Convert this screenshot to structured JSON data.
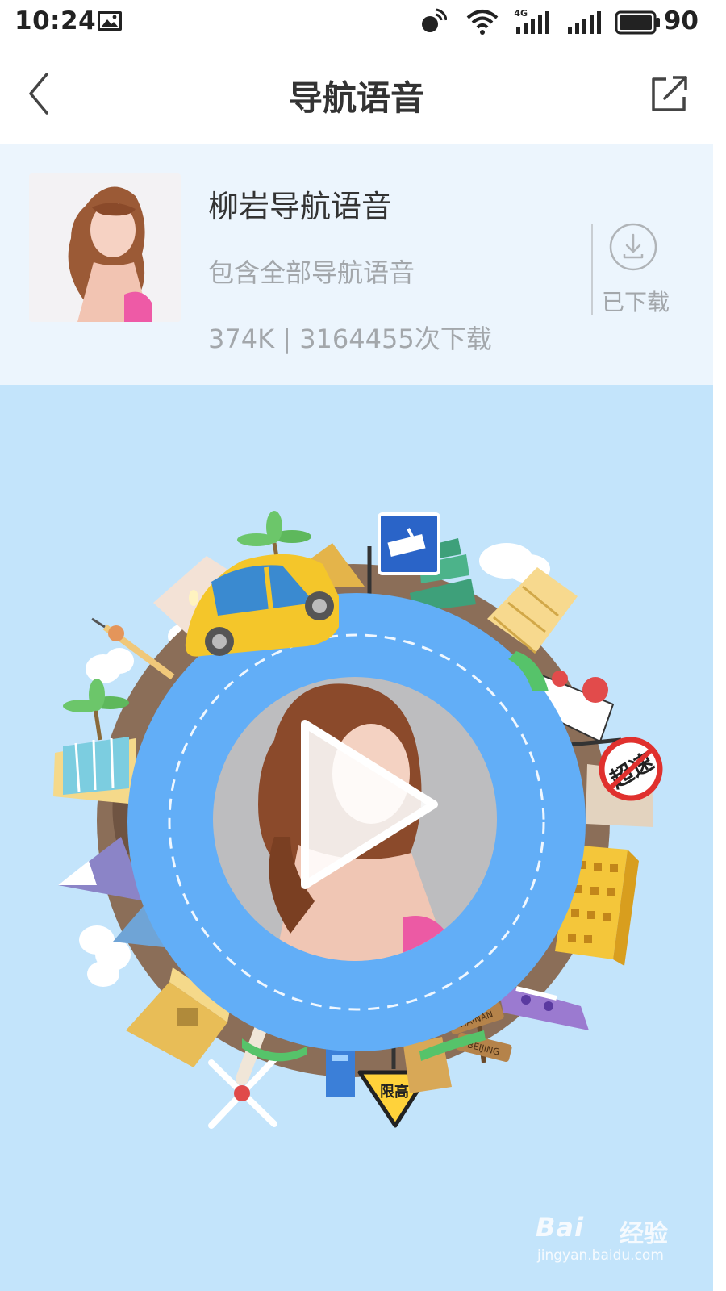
{
  "status_bar": {
    "time": "10:24",
    "network_label": "4G",
    "battery": "90"
  },
  "header": {
    "title": "导航语音",
    "back_icon": "chevron-left-icon",
    "share_icon": "share-external-icon"
  },
  "voice_pack": {
    "name": "柳岩导航语音",
    "description": "包含全部导航语音",
    "meta": "374K | 3164455次下载",
    "download_status": "已下载",
    "download_icon": "download-icon"
  },
  "player": {
    "play_icon": "play-icon",
    "signs": {
      "speed_sign": "超速",
      "warning_sign": "限高"
    },
    "signpost": {
      "top": "HAINAN",
      "bottom": "BEIJING"
    }
  },
  "watermark": {
    "main": "Bai",
    "cn": "经验",
    "sub": "jingyan.baidu.com"
  },
  "colors": {
    "accent_blue": "#62aef7",
    "card_bg": "#ecf5fd",
    "scene_bg": "#c3e4fb",
    "muted_text": "#a3a7ab"
  }
}
